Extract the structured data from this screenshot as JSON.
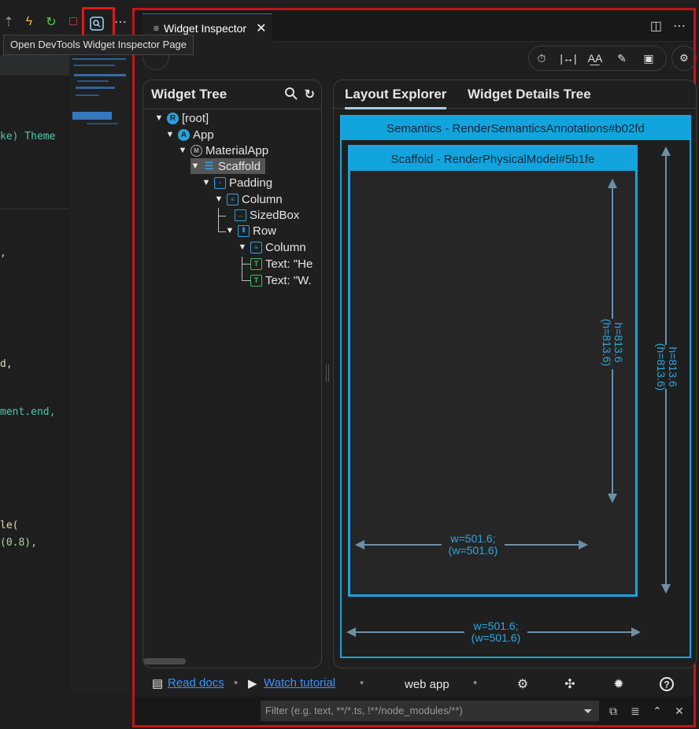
{
  "toolbar": {
    "tooltip": "Open DevTools Widget Inspector Page"
  },
  "editor": {
    "lines": [
      "ke) Theme",
      ",",
      "d,",
      "ment.end,",
      "le(",
      "(0.8),"
    ]
  },
  "tab": {
    "title": "Widget Inspector"
  },
  "widget_tree": {
    "title": "Widget Tree",
    "nodes": [
      {
        "label": "[root]",
        "icon_text": "R"
      },
      {
        "label": "App",
        "icon_text": "A"
      },
      {
        "label": "MaterialApp",
        "icon_text": "M"
      },
      {
        "label": "Scaffold",
        "icon_text": ""
      },
      {
        "label": "Padding",
        "icon_text": ""
      },
      {
        "label": "Column",
        "icon_text": ""
      },
      {
        "label": "SizedBox",
        "icon_text": ""
      },
      {
        "label": "Row",
        "icon_text": ""
      },
      {
        "label": "Column",
        "icon_text": ""
      },
      {
        "label": "Text: \"He",
        "icon_text": "T"
      },
      {
        "label": "Text: \"W.",
        "icon_text": "T"
      }
    ]
  },
  "layout": {
    "tabs": [
      "Layout Explorer",
      "Widget Details Tree"
    ],
    "semantics_header": "Semantics - RenderSemanticsAnnotations#b02fd",
    "scaffold_header": "Scaffold - RenderPhysicalModel#5b1fe",
    "inner_height": [
      "h=813.6",
      "(h=813.6)"
    ],
    "inner_width": [
      "w=501.6;",
      "(w=501.6)"
    ],
    "outer_height": [
      "h=813.6",
      "(h=813.6)"
    ],
    "outer_width": [
      "w=501.6;",
      "(w=501.6)"
    ]
  },
  "footer": {
    "read_docs": "Read docs",
    "watch_tutorial": "Watch tutorial",
    "mode": "web app"
  },
  "filter": {
    "placeholder": "Filter (e.g. text, **/*.ts, !**/node_modules/**)"
  },
  "colors": {
    "accent": "#1aa3dd",
    "highlight": "#c0161a",
    "link": "#3794ff"
  }
}
